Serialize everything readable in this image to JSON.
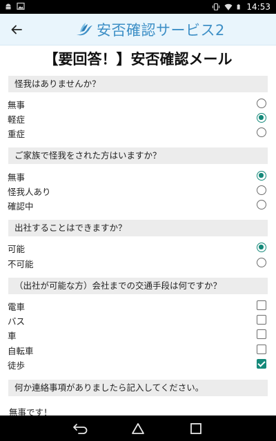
{
  "status_bar": {
    "time": "14:53",
    "icons": [
      "android-icon",
      "image-icon",
      "vibrate-icon",
      "wifi-icon",
      "battery-icon"
    ]
  },
  "header": {
    "back_icon": "arrow-left-icon",
    "app_name": "安否確認サービス2",
    "logo_icon": "dove-icon"
  },
  "title": "【要回答！】安否確認メール",
  "sections": [
    {
      "question": "怪我はありませんか？",
      "type": "radio",
      "options": [
        {
          "label": "無事",
          "selected": false
        },
        {
          "label": "軽症",
          "selected": true
        },
        {
          "label": "重症",
          "selected": false
        }
      ]
    },
    {
      "question": "ご家族で怪我をされた方はいますか？",
      "type": "radio",
      "options": [
        {
          "label": "無事",
          "selected": true
        },
        {
          "label": "怪我人あり",
          "selected": false
        },
        {
          "label": "確認中",
          "selected": false
        }
      ]
    },
    {
      "question": "出社することはできますか？",
      "type": "radio",
      "options": [
        {
          "label": "可能",
          "selected": true
        },
        {
          "label": "不可能",
          "selected": false
        }
      ]
    },
    {
      "question": "（出社が可能な方）会社までの交通手段は何ですか？",
      "type": "checkbox",
      "options": [
        {
          "label": "電車",
          "selected": false
        },
        {
          "label": "バス",
          "selected": false
        },
        {
          "label": "車",
          "selected": false
        },
        {
          "label": "自転車",
          "selected": false
        },
        {
          "label": "徒歩",
          "selected": true
        }
      ]
    },
    {
      "question": "何か連絡事項がありましたら記入してください。",
      "type": "text",
      "value": "無事です！"
    }
  ],
  "nav_bar": {
    "icons": [
      "back-nav-icon",
      "home-nav-icon",
      "recents-nav-icon"
    ]
  },
  "colors": {
    "accent": "#15897a",
    "header_bg": "#e9f5fc",
    "brand": "#3d8fc6",
    "section_bg": "#ececec"
  }
}
